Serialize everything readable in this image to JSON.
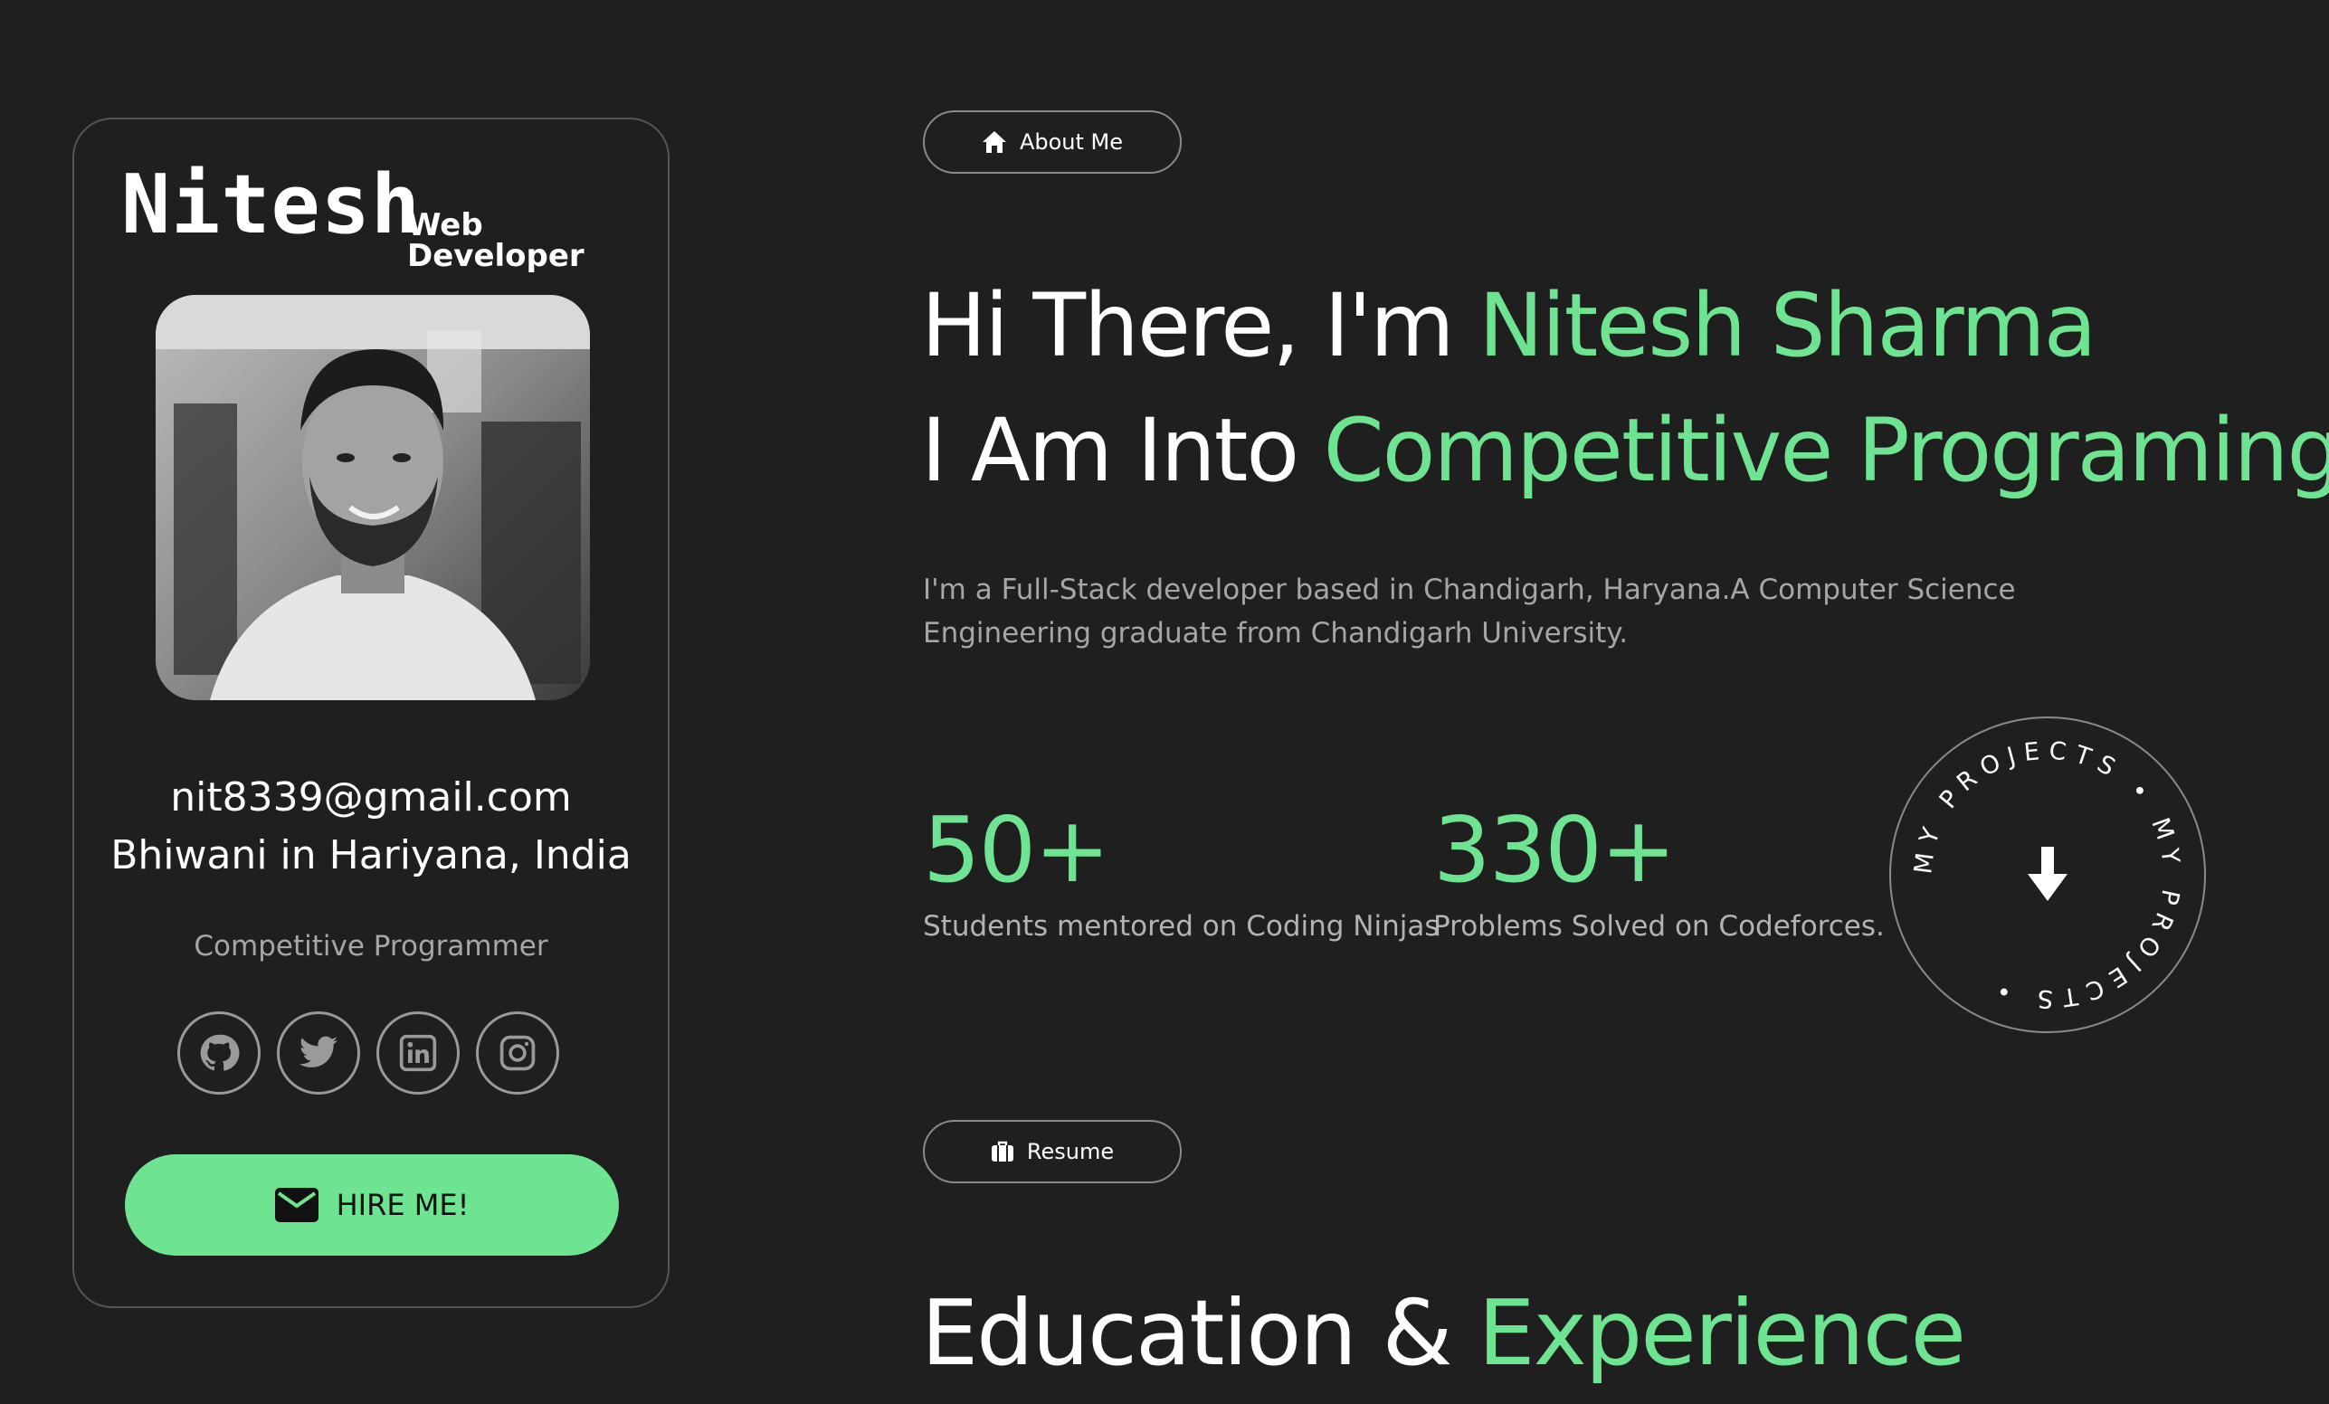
{
  "profile": {
    "name": "Nitesh",
    "role": "Web Developer",
    "email": "nit8339@gmail.com",
    "location": "Bhiwani in Hariyana, India",
    "tagline": "Competitive Programmer",
    "socials": [
      {
        "icon": "github-icon"
      },
      {
        "icon": "twitter-icon"
      },
      {
        "icon": "linkedin-icon"
      },
      {
        "icon": "instagram-icon"
      }
    ],
    "hire_label": "HIRE ME!"
  },
  "nav": {
    "about_label": "About Me",
    "resume_label": "Resume"
  },
  "hero": {
    "line1_prefix": "Hi There, I'm ",
    "line1_highlight": "Nitesh Sharma",
    "line2_prefix": "I Am Into ",
    "line2_highlight": "Competitive Programing",
    "cursor": "_",
    "bio": "I'm a Full-Stack developer based in Chandigarh, Haryana.A Computer Science Engineering graduate from Chandigarh University."
  },
  "stats": [
    {
      "value": "50+",
      "label": "Students mentored on Coding Ninjas"
    },
    {
      "value": "330+",
      "label": "Problems Solved on Codeforces."
    }
  ],
  "projects_badge": {
    "text": "MY PROJECTS • MY PROJECTS •"
  },
  "education": {
    "title_prefix": "Education & ",
    "title_highlight": "Experience"
  },
  "colors": {
    "background": "#1f1f1f",
    "accent": "#6ee391",
    "muted_text": "#a6a6a6",
    "border": "#555555"
  }
}
